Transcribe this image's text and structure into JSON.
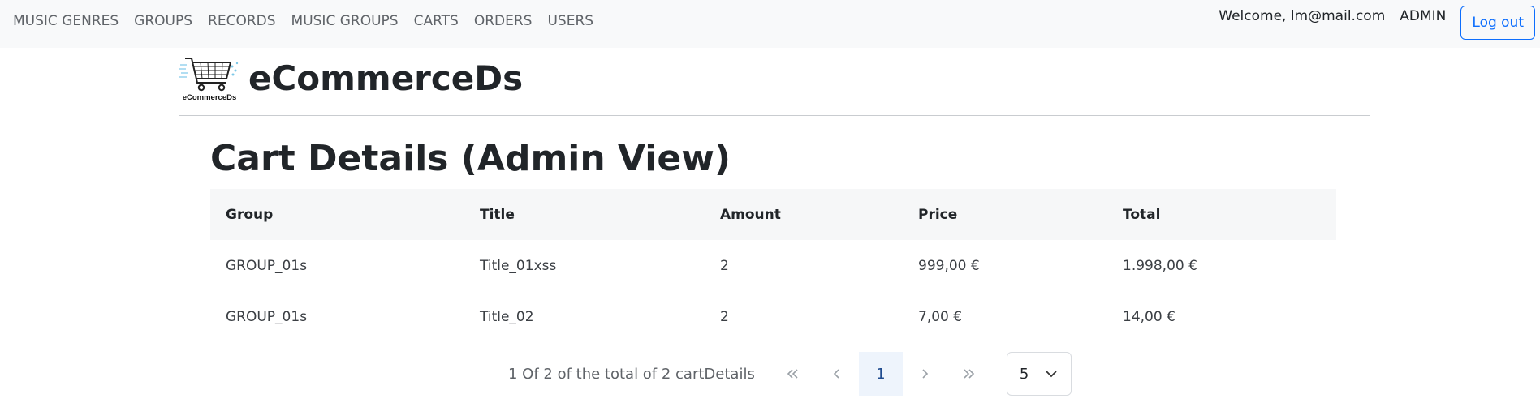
{
  "navbar": {
    "links": [
      {
        "label": "MUSIC GENRES"
      },
      {
        "label": "GROUPS"
      },
      {
        "label": "RECORDS"
      },
      {
        "label": "MUSIC GROUPS"
      },
      {
        "label": "CARTS"
      },
      {
        "label": "ORDERS"
      },
      {
        "label": "USERS"
      }
    ],
    "welcome": "Welcome, lm@mail.com",
    "role": "ADMIN",
    "logout_label": "Log out"
  },
  "brand": {
    "logo_text": "eCommerceDs",
    "name": "eCommerceDs"
  },
  "page": {
    "title": "Cart Details (Admin View)"
  },
  "table": {
    "headers": {
      "group": "Group",
      "title": "Title",
      "amount": "Amount",
      "price": "Price",
      "total": "Total"
    },
    "rows": [
      {
        "group": "GROUP_01s",
        "title": "Title_01xss",
        "amount": "2",
        "price": "999,00 €",
        "total": "1.998,00 €"
      },
      {
        "group": "GROUP_01s",
        "title": "Title_02",
        "amount": "2",
        "price": "7,00 €",
        "total": "14,00 €"
      }
    ]
  },
  "pagination": {
    "info": "1 Of 2 of the total of 2 cartDetails",
    "current_page": "1",
    "page_size": "5",
    "icons": {
      "first": "double-chevron-left-icon",
      "prev": "chevron-left-icon",
      "next": "chevron-right-icon",
      "last": "double-chevron-right-icon",
      "dropdown": "chevron-down-icon"
    }
  },
  "colors": {
    "accent": "#0d6efd",
    "navbar_bg": "#f8f9fa",
    "table_header_bg": "#f6f7f8",
    "current_page_bg": "#eef4fc"
  }
}
